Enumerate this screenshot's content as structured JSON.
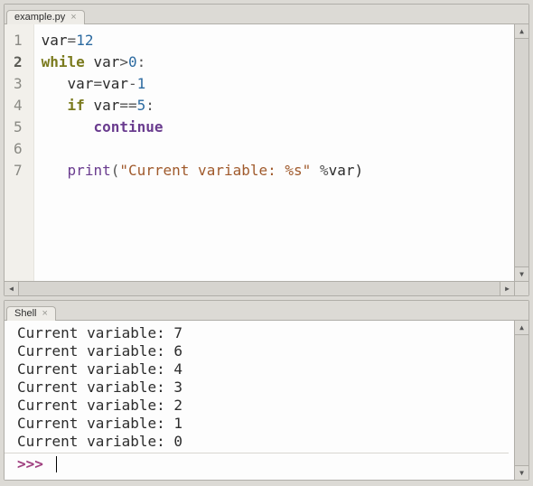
{
  "editor": {
    "tab_label": "example.py",
    "current_line": 2,
    "lines": [
      {
        "n": 1,
        "tokens": [
          {
            "t": "var",
            "c": ""
          },
          {
            "t": "=",
            "c": "op"
          },
          {
            "t": "12",
            "c": "num"
          }
        ]
      },
      {
        "n": 2,
        "tokens": [
          {
            "t": "while",
            "c": "kw"
          },
          {
            "t": " var",
            "c": ""
          },
          {
            "t": ">",
            "c": "op"
          },
          {
            "t": "0",
            "c": "num"
          },
          {
            "t": ":",
            "c": "op"
          }
        ]
      },
      {
        "n": 3,
        "tokens": [
          {
            "t": "   var",
            "c": ""
          },
          {
            "t": "=",
            "c": "op"
          },
          {
            "t": "var",
            "c": ""
          },
          {
            "t": "-",
            "c": "op"
          },
          {
            "t": "1",
            "c": "num"
          }
        ]
      },
      {
        "n": 4,
        "tokens": [
          {
            "t": "   ",
            "c": ""
          },
          {
            "t": "if",
            "c": "kw"
          },
          {
            "t": " var",
            "c": ""
          },
          {
            "t": "==",
            "c": "op"
          },
          {
            "t": "5",
            "c": "num"
          },
          {
            "t": ":",
            "c": "op"
          }
        ]
      },
      {
        "n": 5,
        "tokens": [
          {
            "t": "      ",
            "c": ""
          },
          {
            "t": "continue",
            "c": "kw2"
          }
        ]
      },
      {
        "n": 6,
        "tokens": []
      },
      {
        "n": 7,
        "tokens": [
          {
            "t": "   ",
            "c": ""
          },
          {
            "t": "print",
            "c": "builtin"
          },
          {
            "t": "(",
            "c": "op"
          },
          {
            "t": "\"Current variable: %s\"",
            "c": "str"
          },
          {
            "t": " ",
            "c": ""
          },
          {
            "t": "%",
            "c": "op"
          },
          {
            "t": "var)",
            "c": ""
          }
        ]
      }
    ]
  },
  "shell": {
    "tab_label": "Shell",
    "output_lines": [
      "Current variable: 7",
      "Current variable: 6",
      "Current variable: 4",
      "Current variable: 3",
      "Current variable: 2",
      "Current variable: 1",
      "Current variable: 0"
    ],
    "prompt": ">>> "
  }
}
